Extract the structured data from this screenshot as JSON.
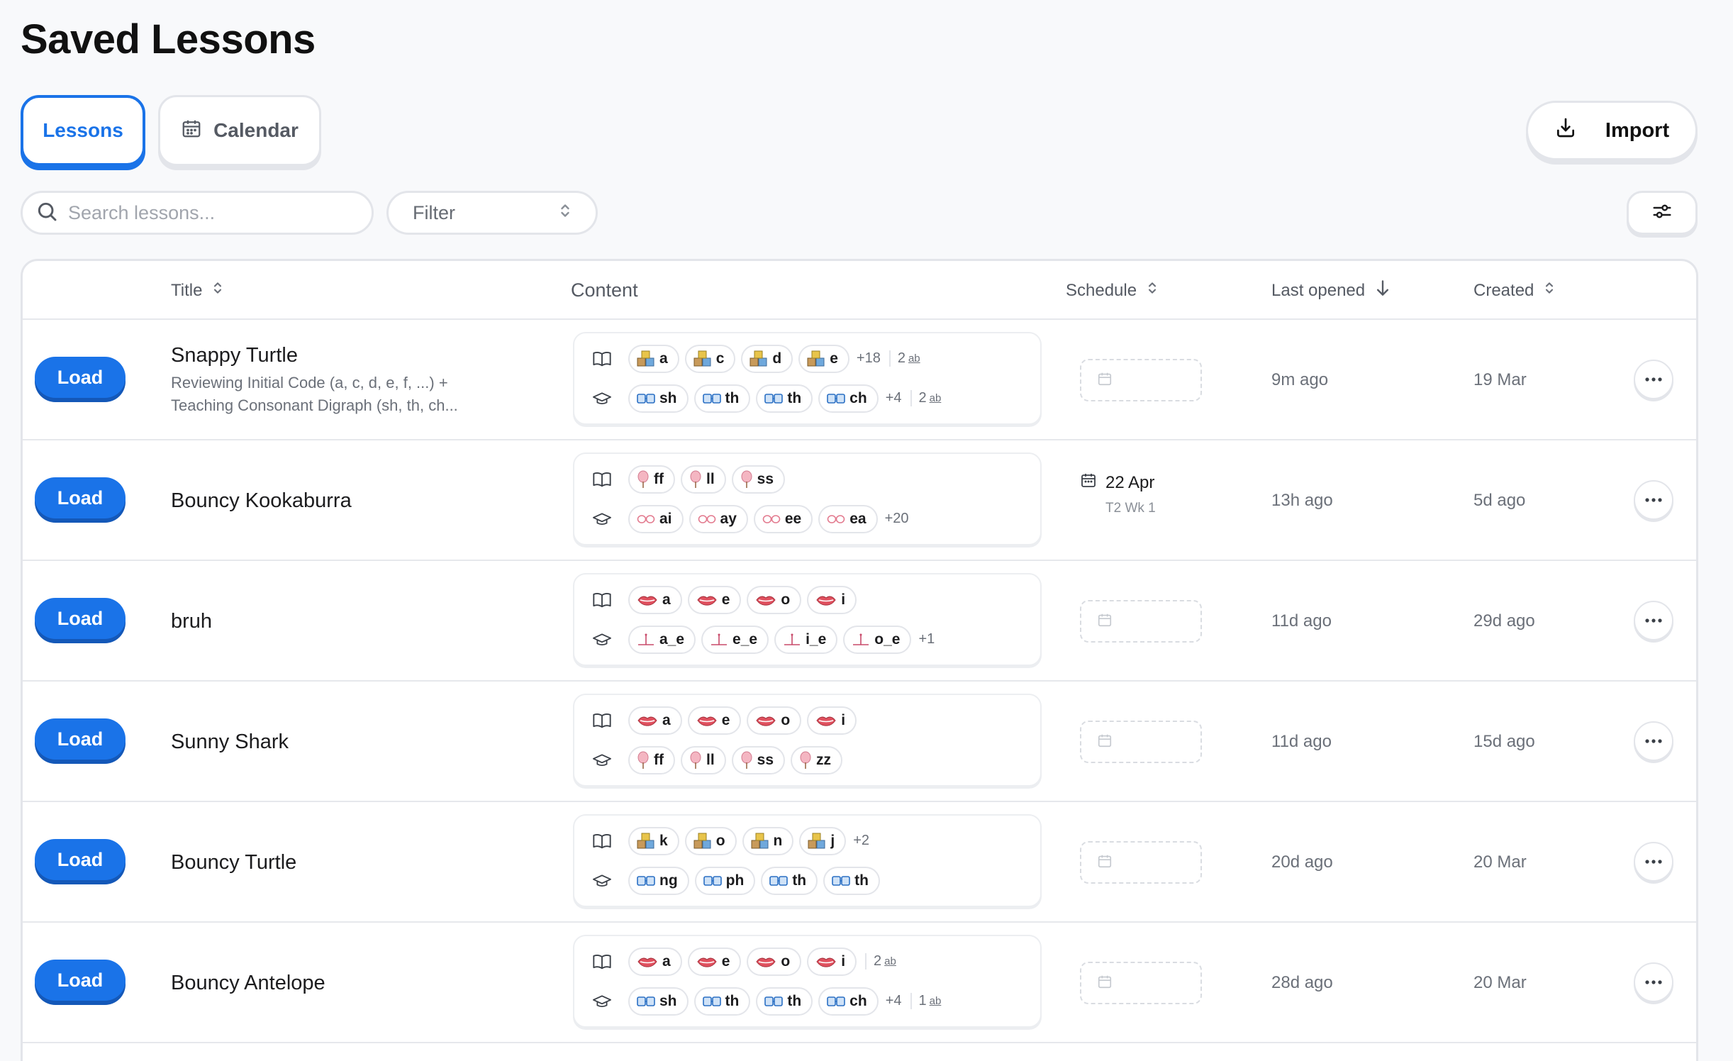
{
  "page": {
    "title": "Saved Lessons"
  },
  "tabs": {
    "lessons": "Lessons",
    "calendar": "Calendar"
  },
  "toolbar": {
    "import_label": "Import",
    "search_placeholder": "Search lessons...",
    "filter_label": "Filter"
  },
  "colors": {
    "accent": "#1a73e8",
    "border": "#e3e5ea"
  },
  "table": {
    "headers": {
      "title": "Title",
      "content": "Content",
      "schedule": "Schedule",
      "last_opened": "Last opened",
      "created": "Created"
    },
    "load_label": "Load",
    "rows": [
      {
        "title": "Snappy Turtle",
        "subtitle_1": "Reviewing Initial Code (a, c, d, e, f, ...) +",
        "subtitle_2": "Teaching Consonant Digraph (sh, th, ch...",
        "review_icon": "book-icon",
        "teach_icon": "graduation-cap-icon",
        "review": [
          {
            "icon": "blocks-icon",
            "text": "a"
          },
          {
            "icon": "blocks-icon",
            "text": "c"
          },
          {
            "icon": "blocks-icon",
            "text": "d"
          },
          {
            "icon": "blocks-icon",
            "text": "e"
          }
        ],
        "review_more": "+18",
        "review_words": "2",
        "teach": [
          {
            "icon": "digraph-icon",
            "text": "sh"
          },
          {
            "icon": "digraph-icon",
            "text": "th"
          },
          {
            "icon": "digraph-icon",
            "text": "th"
          },
          {
            "icon": "digraph-icon",
            "text": "ch"
          }
        ],
        "teach_more": "+4",
        "teach_words": "2",
        "schedule": null,
        "last_opened": "9m ago",
        "created": "19 Mar"
      },
      {
        "title": "Bouncy Kookaburra",
        "review": [
          {
            "icon": "cotton-candy-icon",
            "text": "ff"
          },
          {
            "icon": "cotton-candy-icon",
            "text": "ll"
          },
          {
            "icon": "cotton-candy-icon",
            "text": "ss"
          }
        ],
        "review_more": "",
        "review_words": "",
        "teach": [
          {
            "icon": "vowel-team-icon",
            "text": "ai"
          },
          {
            "icon": "vowel-team-icon",
            "text": "ay"
          },
          {
            "icon": "vowel-team-icon",
            "text": "ee"
          },
          {
            "icon": "vowel-team-icon",
            "text": "ea"
          }
        ],
        "teach_more": "+20",
        "teach_words": "",
        "schedule": {
          "date": "22 Apr",
          "week": "T2 Wk 1"
        },
        "last_opened": "13h ago",
        "created": "5d ago"
      },
      {
        "title": "bruh",
        "review": [
          {
            "icon": "lips-icon",
            "text": "a"
          },
          {
            "icon": "lips-icon",
            "text": "e"
          },
          {
            "icon": "lips-icon",
            "text": "o"
          },
          {
            "icon": "lips-icon",
            "text": "i"
          }
        ],
        "review_more": "",
        "review_words": "",
        "teach": [
          {
            "icon": "split-digraph-icon",
            "text": "a_e"
          },
          {
            "icon": "split-digraph-icon",
            "text": "e_e"
          },
          {
            "icon": "split-digraph-icon",
            "text": "i_e"
          },
          {
            "icon": "split-digraph-icon",
            "text": "o_e"
          }
        ],
        "teach_more": "+1",
        "teach_words": "",
        "schedule": null,
        "last_opened": "11d ago",
        "created": "29d ago"
      },
      {
        "title": "Sunny Shark",
        "review": [
          {
            "icon": "lips-icon",
            "text": "a"
          },
          {
            "icon": "lips-icon",
            "text": "e"
          },
          {
            "icon": "lips-icon",
            "text": "o"
          },
          {
            "icon": "lips-icon",
            "text": "i"
          }
        ],
        "review_more": "",
        "review_words": "",
        "teach": [
          {
            "icon": "cotton-candy-icon",
            "text": "ff"
          },
          {
            "icon": "cotton-candy-icon",
            "text": "ll"
          },
          {
            "icon": "cotton-candy-icon",
            "text": "ss"
          },
          {
            "icon": "cotton-candy-icon",
            "text": "zz"
          }
        ],
        "teach_more": "",
        "teach_words": "",
        "schedule": null,
        "last_opened": "11d ago",
        "created": "15d ago"
      },
      {
        "title": "Bouncy Turtle",
        "review": [
          {
            "icon": "blocks-icon",
            "text": "k"
          },
          {
            "icon": "blocks-icon",
            "text": "o"
          },
          {
            "icon": "blocks-icon",
            "text": "n"
          },
          {
            "icon": "blocks-icon",
            "text": "j"
          }
        ],
        "review_more": "+2",
        "review_words": "",
        "teach": [
          {
            "icon": "digraph-icon",
            "text": "ng"
          },
          {
            "icon": "digraph-icon",
            "text": "ph"
          },
          {
            "icon": "digraph-icon",
            "text": "th"
          },
          {
            "icon": "digraph-icon",
            "text": "th"
          }
        ],
        "teach_more": "",
        "teach_words": "",
        "schedule": null,
        "last_opened": "20d ago",
        "created": "20 Mar"
      },
      {
        "title": "Bouncy Antelope",
        "review": [
          {
            "icon": "lips-icon",
            "text": "a"
          },
          {
            "icon": "lips-icon",
            "text": "e"
          },
          {
            "icon": "lips-icon",
            "text": "o"
          },
          {
            "icon": "lips-icon",
            "text": "i"
          }
        ],
        "review_more": "",
        "review_words": "2",
        "teach": [
          {
            "icon": "digraph-icon",
            "text": "sh"
          },
          {
            "icon": "digraph-icon",
            "text": "th"
          },
          {
            "icon": "digraph-icon",
            "text": "th"
          },
          {
            "icon": "digraph-icon",
            "text": "ch"
          }
        ],
        "teach_more": "+4",
        "teach_words": "1",
        "schedule": null,
        "last_opened": "28d ago",
        "created": "20 Mar"
      }
    ]
  }
}
